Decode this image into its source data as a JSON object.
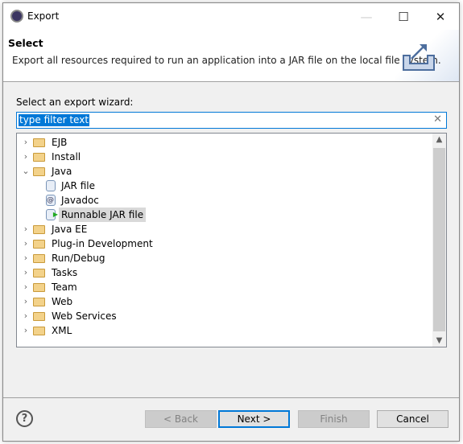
{
  "window": {
    "title": "Export"
  },
  "header": {
    "title": "Select",
    "description": "Export all resources required to run an application into a JAR file on the local file system."
  },
  "filter": {
    "label": "Select an export wizard:",
    "value": "type filter text"
  },
  "tree": [
    {
      "label": "EJB",
      "type": "folder",
      "level": 0,
      "expanded": false
    },
    {
      "label": "Install",
      "type": "folder",
      "level": 0,
      "expanded": false
    },
    {
      "label": "Java",
      "type": "folder",
      "level": 0,
      "expanded": true
    },
    {
      "label": "JAR file",
      "type": "jar",
      "level": 1
    },
    {
      "label": "Javadoc",
      "type": "javadoc",
      "level": 1
    },
    {
      "label": "Runnable JAR file",
      "type": "runnable-jar",
      "level": 1,
      "selected": true
    },
    {
      "label": "Java EE",
      "type": "folder",
      "level": 0,
      "expanded": false
    },
    {
      "label": "Plug-in Development",
      "type": "folder",
      "level": 0,
      "expanded": false
    },
    {
      "label": "Run/Debug",
      "type": "folder",
      "level": 0,
      "expanded": false
    },
    {
      "label": "Tasks",
      "type": "folder",
      "level": 0,
      "expanded": false
    },
    {
      "label": "Team",
      "type": "folder",
      "level": 0,
      "expanded": false
    },
    {
      "label": "Web",
      "type": "folder",
      "level": 0,
      "expanded": false
    },
    {
      "label": "Web Services",
      "type": "folder",
      "level": 0,
      "expanded": false
    },
    {
      "label": "XML",
      "type": "folder",
      "level": 0,
      "expanded": false
    }
  ],
  "buttons": {
    "back": "< Back",
    "next": "Next >",
    "finish": "Finish",
    "cancel": "Cancel"
  },
  "colors": {
    "accent": "#0078d7"
  }
}
